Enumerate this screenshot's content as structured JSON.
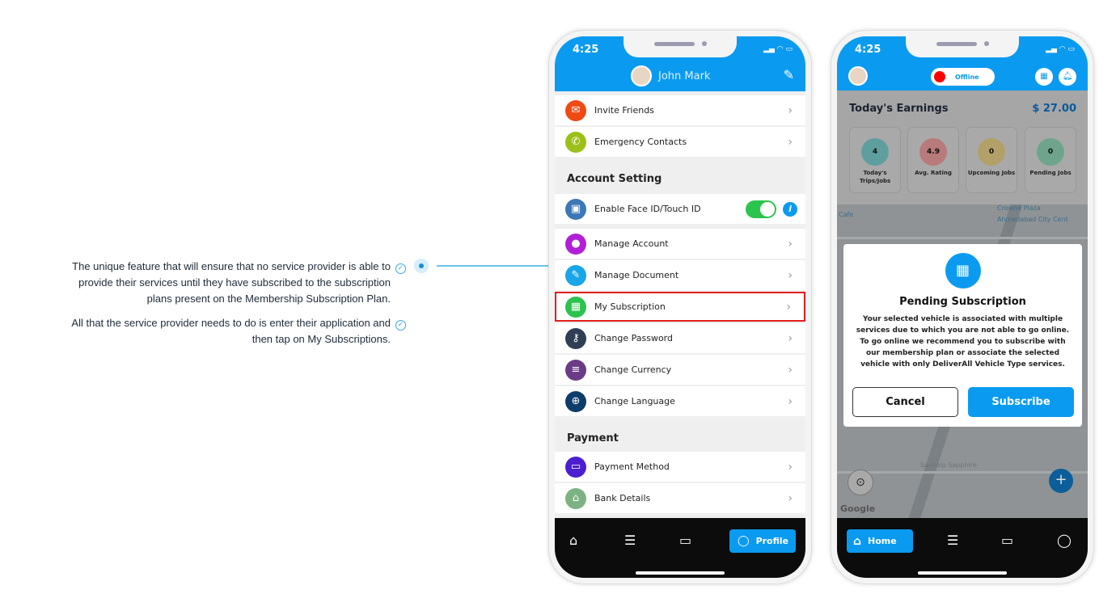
{
  "notes": [
    {
      "text_lines": [
        "The unique feature that will ensure that no service provider is able to",
        "provide their services until they have subscribed to the subscription",
        "plans present on the Membership Subscription Plan."
      ]
    },
    {
      "text_lines": [
        "All that the service provider needs to do is enter their application and",
        "then tap on My Subscriptions."
      ]
    }
  ],
  "colors": {
    "brand": "#0a9bf0",
    "highlight": "#e41e1e",
    "toggle": "#2dc44e",
    "offline": "#ff0000"
  },
  "phone1": {
    "status_time": "4:25",
    "user_name": "John Mark",
    "items_top": [
      {
        "label": "Invite Friends",
        "icon": "mail-icon",
        "color": "#f04a14"
      },
      {
        "label": "Emergency Contacts",
        "icon": "phone-icon",
        "color": "#9cc01a"
      }
    ],
    "section_account": "Account Setting",
    "face_id": {
      "label": "Enable Face ID/Touch ID",
      "enabled": true
    },
    "items_account": [
      {
        "label": "Manage Account",
        "icon": "user-icon",
        "color": "#b11fd6"
      },
      {
        "label": "Manage Document",
        "icon": "document-icon",
        "color": "#18a6e8"
      },
      {
        "label": "My Subscription",
        "icon": "subscription-icon",
        "color": "#2cc24f",
        "highlighted": true
      },
      {
        "label": "Change Password",
        "icon": "key-icon",
        "color": "#2e3f55"
      },
      {
        "label": "Change Currency",
        "icon": "currency-icon",
        "color": "#6a3c88"
      },
      {
        "label": "Change Language",
        "icon": "globe-icon",
        "color": "#0e3c6b"
      }
    ],
    "section_payment": "Payment",
    "items_payment": [
      {
        "label": "Payment Method",
        "icon": "card-icon",
        "color": "#4b1fd1"
      },
      {
        "label": "Bank Details",
        "icon": "bank-icon",
        "color": "#7db382"
      }
    ],
    "nav": {
      "active_label": "Profile"
    }
  },
  "phone2": {
    "status_time": "4:25",
    "status_label": "Offline",
    "earnings_title": "Today's Earnings",
    "earnings_value": "$ 27.00",
    "stats": [
      {
        "value": "4",
        "label": "Today's Trips/Jobs",
        "color": "#5f9e9e"
      },
      {
        "value": "4.9",
        "label": "Avg. Rating",
        "color": "#b87a7a"
      },
      {
        "value": "0",
        "label": "Upcoming Jobs",
        "color": "#b3a068"
      },
      {
        "value": "0",
        "label": "Pending Jobs",
        "color": "#6ea58a"
      }
    ],
    "map_labels": [
      "Cafe",
      "Crowne Plaza",
      "Ahmedabad City Cent",
      "Sankalp Sapphire",
      "Google"
    ],
    "dialog": {
      "title": "Pending Subscription",
      "body": "Your selected vehicle is associated with multiple services due to which you are not able to go online. To go online we recommend you to subscribe with our membership plan or associate the selected vehicle with only DeliverAll Vehicle Type services.",
      "cancel": "Cancel",
      "subscribe": "Subscribe"
    },
    "nav": {
      "active_label": "Home"
    }
  }
}
